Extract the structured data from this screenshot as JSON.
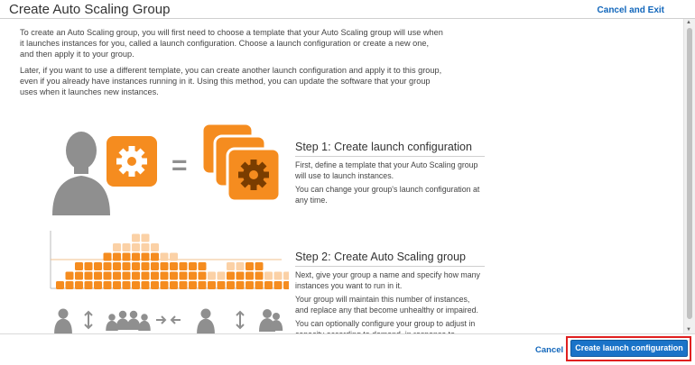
{
  "header": {
    "title": "Create Auto Scaling Group",
    "cancel_exit_label": "Cancel and Exit"
  },
  "intro": {
    "paragraph1": "To create an Auto Scaling group, you will first need to choose a template that your Auto Scaling group will use when it launches instances for you, called a launch configuration. Choose a launch configuration or create a new one, and then apply it to your group.",
    "paragraph2": "Later, if you want to use a different template, you can create another launch configuration and apply it to this group, even if you already have instances running in it. Using this method, you can update the software that your group uses when it launches new instances."
  },
  "step1": {
    "title": "Step 1: Create launch configuration",
    "text1": "First, define a template that your Auto Scaling group will use to launch instances.",
    "text2": "You can change your group's launch configuration at any time."
  },
  "step2": {
    "title": "Step 2: Create Auto Scaling group",
    "text1": "Next, give your group a name and specify how many instances you want to run in it.",
    "text2": "Your group will maintain this number of instances, and replace any that become unhealthy or impaired.",
    "text3": "You can optionally configure your group to adjust in capacity according to demand, in response to"
  },
  "illustration": {
    "equals_sign": "=",
    "icons": [
      "user-silhouette-icon",
      "gear-icon",
      "stacked-gears-icon",
      "up-down-arrow-icon",
      "group-icon",
      "shrink-arrows-icon"
    ],
    "accent_color": "#f58c1f",
    "light_accent_color": "#fbd1a6",
    "gray_color": "#8f8f8f"
  },
  "footer": {
    "cancel_label": "Cancel",
    "create_label": "Create launch configuration"
  },
  "colors": {
    "link": "#1166bb",
    "primary_button": "#1a73c8",
    "highlight_outline": "#e02020"
  }
}
